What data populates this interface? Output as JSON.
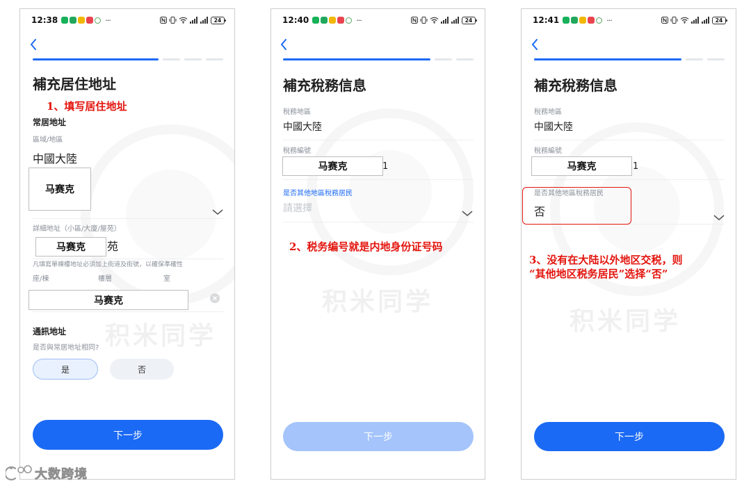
{
  "colors": {
    "primary": "#1b6af5",
    "primary_disabled": "#a4c4fb",
    "annotation_red": "#e3140d"
  },
  "status_bar": {
    "notification_icons": [
      {
        "name": "notification-green-icon",
        "color": "#17b15a"
      },
      {
        "name": "notification-green-icon",
        "color": "#21a85c"
      },
      {
        "name": "notification-yellow-icon",
        "color": "#f2b705"
      },
      {
        "name": "notification-red-icon",
        "color": "#e8434f"
      },
      {
        "name": "notification-outline-icon",
        "color": "#58a65c",
        "outline": true
      }
    ],
    "system_icons": [
      "nfc-icon",
      "vibrate-icon",
      "wifi-icon",
      "signal-icon",
      "signal-icon",
      "battery-icon"
    ]
  },
  "watermark": "积米同学",
  "corner_watermark": "大数跨境",
  "screens": [
    {
      "status": {
        "time": "12:38",
        "more": "···",
        "battery": "24"
      },
      "progress": {
        "completed": 6,
        "total": 9
      },
      "title": "補充居住地址",
      "annotation": "1、填写居住地址",
      "residence_heading": "常居地址",
      "region_label": "區域/地區",
      "region_value": "中國大陸",
      "district_mosaic": "马赛克",
      "detail_label": "詳細地址（小區/大廈/屋苑）",
      "detail_mosaic": "马赛克",
      "detail_suffix": "苑",
      "detail_hint": "凡填寫單棟樓地址必須加上街道及街號，以確保準確性",
      "unit_labels": {
        "block": "座/棟",
        "floor": "樓層",
        "room": "室"
      },
      "unit_mosaic": "马赛克",
      "mailing_heading": "通訊地址",
      "same_question": "是否與常居地址相同?",
      "options": {
        "yes": "是",
        "no": "否",
        "selected": "是"
      },
      "next_label": "下一步",
      "next_enabled": true
    },
    {
      "status": {
        "time": "12:40",
        "more": "···",
        "battery": "24"
      },
      "progress": {
        "completed": 7,
        "total": 9
      },
      "title": "補充稅務信息",
      "tax_region_label": "稅務地區",
      "tax_region_value": "中國大陸",
      "tax_id_label": "稅務編號",
      "tax_id_mosaic": "马赛克",
      "tax_id_suffix": "1",
      "other_resident_label": "是否其他地區稅務居民",
      "other_resident_placeholder": "請選擇",
      "annotation": "2、税务编号就是内地身份证号码",
      "next_label": "下一步",
      "next_enabled": false
    },
    {
      "status": {
        "time": "12:41",
        "more": "···",
        "battery": "24"
      },
      "progress": {
        "completed": 7,
        "total": 9
      },
      "title": "補充稅務信息",
      "tax_region_label": "稅務地區",
      "tax_region_value": "中國大陸",
      "tax_id_label": "稅務編號",
      "tax_id_mosaic": "马赛克",
      "tax_id_suffix": "1",
      "other_resident_label": "是否其他地區稅務居民",
      "other_resident_value": "否",
      "annotation_lines": [
        "3、没有在大陆以外地区交税，则",
        "“其他地区税务居民”选择“否”"
      ],
      "next_label": "下一步",
      "next_enabled": true
    }
  ]
}
